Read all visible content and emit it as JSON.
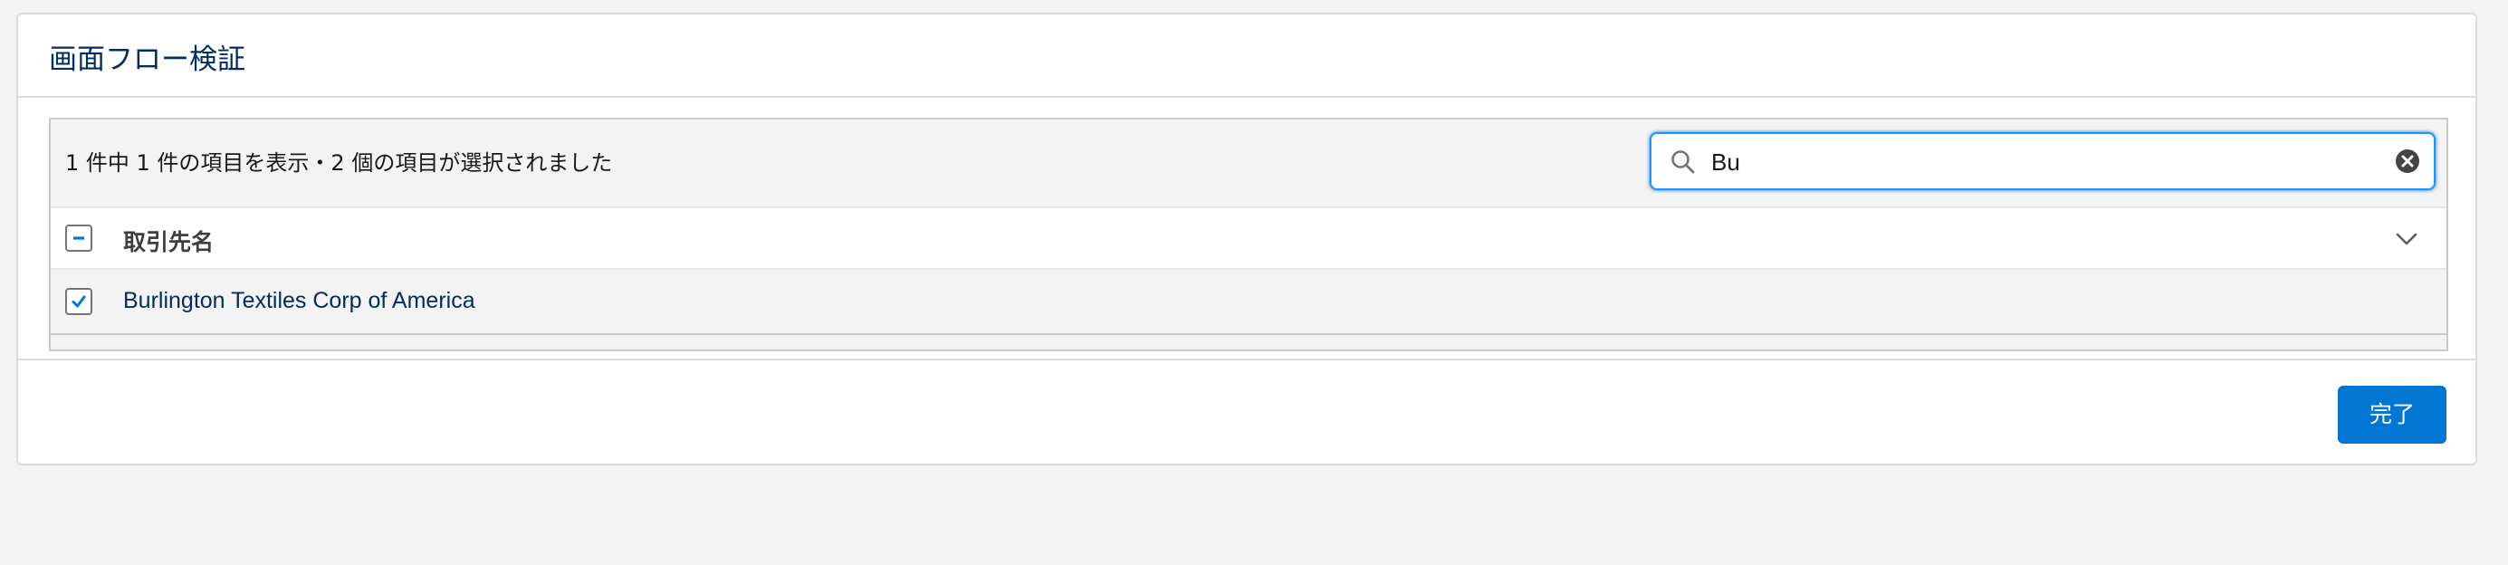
{
  "card": {
    "title": "画面フロー検証"
  },
  "table": {
    "info_text": "1 件中 1 件の項目を表示・2 個の項目が選択されました",
    "search": {
      "value": "Bu",
      "icon": "search-icon",
      "clear_icon": "clear-icon"
    },
    "columns": [
      {
        "label": "取引先名",
        "sort_icon": "chevron-down-icon"
      }
    ],
    "header_checkbox_state": "indeterminate",
    "rows": [
      {
        "name": "Burlington Textiles Corp of America",
        "checked": true
      }
    ]
  },
  "footer": {
    "done_label": "完了"
  },
  "colors": {
    "brand": "#0176d3",
    "title_text": "#032d60",
    "background": "#f3f3f3"
  }
}
